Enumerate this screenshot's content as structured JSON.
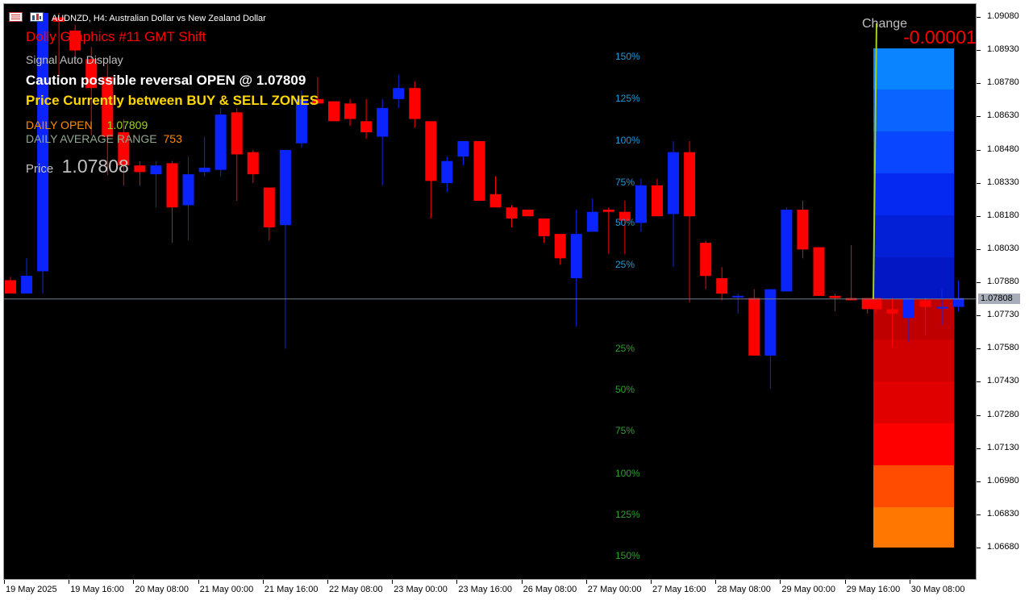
{
  "window": {
    "title": "AUDNZD, H4:  Australian Dollar vs New Zealand Dollar",
    "symbol": "AUDNZD",
    "timeframe": "H4"
  },
  "overlay": {
    "indicator_name": "Dolly Graphics #11 GMT Shift",
    "signal_mode": "Signal Auto Display",
    "signal_text": "Caution possible reversal  OPEN @ 1.07809",
    "zone_text": "Price Currently between BUY & SELL ZONES",
    "daily_open_label": "DAILY OPEN",
    "daily_open_value": "1.07809",
    "dar_label": "DAILY AVERAGE RANGE",
    "dar_value": "753",
    "price_label": "Price",
    "price_value": "1.07808",
    "change_label": "Change",
    "change_value": "-0.00001"
  },
  "levels_upper": [
    "150%",
    "125%",
    "100%",
    "75%",
    "50%",
    "25%"
  ],
  "levels_lower": [
    "25%",
    "50%",
    "75%",
    "100%",
    "125%",
    "150%"
  ],
  "y_axis": {
    "labels": [
      "1.09080",
      "1.08930",
      "1.08780",
      "1.08630",
      "1.08480",
      "1.08330",
      "1.08180",
      "1.08030",
      "1.07880",
      "1.07730",
      "1.07580",
      "1.07430",
      "1.07280",
      "1.07130",
      "1.06980",
      "1.06830",
      "1.06680"
    ],
    "current_price": "1.07808"
  },
  "x_axis": {
    "labels": [
      "19 May 2025",
      "19 May 16:00",
      "20 May 08:00",
      "21 May 00:00",
      "21 May 16:00",
      "22 May 08:00",
      "23 May 00:00",
      "23 May 16:00",
      "26 May 08:00",
      "27 May 00:00",
      "27 May 16:00",
      "28 May 08:00",
      "29 May 00:00",
      "29 May 16:00",
      "30 May 08:00"
    ]
  },
  "colors": {
    "bull": "#0b24fb",
    "bear": "#ff0000",
    "background": "#000000",
    "overlay_red": "#ff0000",
    "overlay_white": "#ffffff",
    "overlay_yellow": "#ffd700",
    "overlay_orange": "#ff8c00",
    "overlay_gray": "#c0c0c0",
    "level_blue": "#1e9bd7",
    "level_green": "#2ca02c"
  },
  "chart_data": {
    "type": "candlestick",
    "ylim": [
      1.0661,
      1.0913
    ],
    "candles": [
      {
        "o": 1.07893,
        "h": 1.07908,
        "l": 1.07833,
        "c": 1.07833
      },
      {
        "o": 1.07833,
        "h": 1.07992,
        "l": 1.07833,
        "c": 1.07913
      },
      {
        "o": 1.07933,
        "h": 1.09102,
        "l": 1.07833,
        "c": 1.09102
      },
      {
        "o": 1.09082,
        "h": 1.09102,
        "l": 1.08813,
        "c": 1.09062
      },
      {
        "o": 1.09022,
        "h": 1.09048,
        "l": 1.08882,
        "c": 1.08932
      },
      {
        "o": 1.08893,
        "h": 1.08948,
        "l": 1.08548,
        "c": 1.08762
      },
      {
        "o": 1.08812,
        "h": 1.08871,
        "l": 1.08368,
        "c": 1.08542
      },
      {
        "o": 1.08562,
        "h": 1.08621,
        "l": 1.08321,
        "c": 1.08412
      },
      {
        "o": 1.08412,
        "h": 1.08431,
        "l": 1.08321,
        "c": 1.08382
      },
      {
        "o": 1.08372,
        "h": 1.08432,
        "l": 1.08222,
        "c": 1.08412
      },
      {
        "o": 1.08422,
        "h": 1.08432,
        "l": 1.08063,
        "c": 1.08222
      },
      {
        "o": 1.08232,
        "h": 1.08452,
        "l": 1.08072,
        "c": 1.08372
      },
      {
        "o": 1.08382,
        "h": 1.08542,
        "l": 1.08362,
        "c": 1.08402
      },
      {
        "o": 1.08392,
        "h": 1.08672,
        "l": 1.08362,
        "c": 1.08642
      },
      {
        "o": 1.08652,
        "h": 1.08672,
        "l": 1.08252,
        "c": 1.08462
      },
      {
        "o": 1.08472,
        "h": 1.08482,
        "l": 1.08332,
        "c": 1.08372
      },
      {
        "o": 1.08312,
        "h": 1.08312,
        "l": 1.08072,
        "c": 1.08132
      },
      {
        "o": 1.08142,
        "h": 1.08442,
        "l": 1.07583,
        "c": 1.08482
      },
      {
        "o": 1.08512,
        "h": 1.08752,
        "l": 1.08492,
        "c": 1.08712
      },
      {
        "o": 1.08712,
        "h": 1.08812,
        "l": 1.08702,
        "c": 1.08692
      },
      {
        "o": 1.08702,
        "h": 1.08702,
        "l": 1.08612,
        "c": 1.08612
      },
      {
        "o": 1.08692,
        "h": 1.08712,
        "l": 1.08592,
        "c": 1.08622
      },
      {
        "o": 1.08612,
        "h": 1.08712,
        "l": 1.08532,
        "c": 1.08562
      },
      {
        "o": 1.08542,
        "h": 1.08712,
        "l": 1.08322,
        "c": 1.08672
      },
      {
        "o": 1.08712,
        "h": 1.08822,
        "l": 1.08672,
        "c": 1.08762
      },
      {
        "o": 1.08762,
        "h": 1.08792,
        "l": 1.08582,
        "c": 1.08622
      },
      {
        "o": 1.08612,
        "h": 1.08612,
        "l": 1.08172,
        "c": 1.08342
      },
      {
        "o": 1.08332,
        "h": 1.08452,
        "l": 1.08292,
        "c": 1.08432
      },
      {
        "o": 1.08452,
        "h": 1.08522,
        "l": 1.08412,
        "c": 1.08522
      },
      {
        "o": 1.08522,
        "h": 1.08522,
        "l": 1.08262,
        "c": 1.08252
      },
      {
        "o": 1.08282,
        "h": 1.08362,
        "l": 1.08252,
        "c": 1.08222
      },
      {
        "o": 1.08222,
        "h": 1.08232,
        "l": 1.08132,
        "c": 1.08172
      },
      {
        "o": 1.08212,
        "h": 1.08212,
        "l": 1.08182,
        "c": 1.08182
      },
      {
        "o": 1.08172,
        "h": 1.08172,
        "l": 1.08062,
        "c": 1.08092
      },
      {
        "o": 1.08102,
        "h": 1.08102,
        "l": 1.07962,
        "c": 1.07992
      },
      {
        "o": 1.07902,
        "h": 1.08212,
        "l": 1.07682,
        "c": 1.08102
      },
      {
        "o": 1.08112,
        "h": 1.08262,
        "l": 1.08112,
        "c": 1.08202
      },
      {
        "o": 1.08212,
        "h": 1.08222,
        "l": 1.08012,
        "c": 1.08202
      },
      {
        "o": 1.08202,
        "h": 1.08252,
        "l": 1.08012,
        "c": 1.08162
      },
      {
        "o": 1.08152,
        "h": 1.08352,
        "l": 1.08112,
        "c": 1.08322
      },
      {
        "o": 1.08322,
        "h": 1.08352,
        "l": 1.08182,
        "c": 1.08182
      },
      {
        "o": 1.08192,
        "h": 1.08522,
        "l": 1.07952,
        "c": 1.08472
      },
      {
        "o": 1.08472,
        "h": 1.08522,
        "l": 1.07792,
        "c": 1.08182
      },
      {
        "o": 1.08062,
        "h": 1.08072,
        "l": 1.07852,
        "c": 1.07912
      },
      {
        "o": 1.07902,
        "h": 1.07952,
        "l": 1.07802,
        "c": 1.07832
      },
      {
        "o": 1.07822,
        "h": 1.07832,
        "l": 1.07742,
        "c": 1.07822
      },
      {
        "o": 1.07812,
        "h": 1.07852,
        "l": 1.07552,
        "c": 1.07552
      },
      {
        "o": 1.07552,
        "h": 1.07852,
        "l": 1.07402,
        "c": 1.07852
      },
      {
        "o": 1.07842,
        "h": 1.08222,
        "l": 1.07842,
        "c": 1.08212
      },
      {
        "o": 1.08212,
        "h": 1.08252,
        "l": 1.07992,
        "c": 1.08032
      },
      {
        "o": 1.08042,
        "h": 1.08042,
        "l": 1.07822,
        "c": 1.07822
      },
      {
        "o": 1.07822,
        "h": 1.07832,
        "l": 1.07752,
        "c": 1.07812
      },
      {
        "o": 1.07812,
        "h": 1.08052,
        "l": 1.07802,
        "c": 1.07802
      },
      {
        "o": 1.07812,
        "h": 1.07812,
        "l": 1.07742,
        "c": 1.07762
      },
      {
        "o": 1.07762,
        "h": 1.07812,
        "l": 1.07592,
        "c": 1.07742
      },
      {
        "o": 1.07722,
        "h": 1.07812,
        "l": 1.07612,
        "c": 1.07812
      },
      {
        "o": 1.07802,
        "h": 1.07812,
        "l": 1.07642,
        "c": 1.07772
      },
      {
        "o": 1.07772,
        "h": 1.07852,
        "l": 1.07692,
        "c": 1.07772
      },
      {
        "o": 1.07772,
        "h": 1.07892,
        "l": 1.07752,
        "c": 1.07812
      }
    ]
  }
}
